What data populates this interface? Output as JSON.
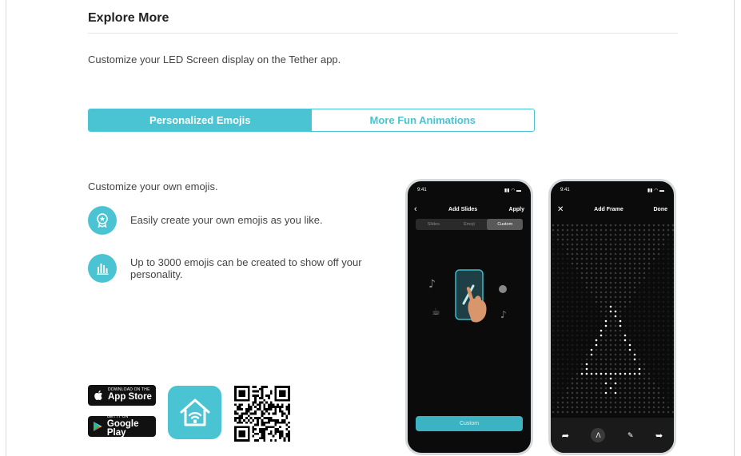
{
  "section_title": "Explore More",
  "subtitle": "Customize your LED Screen display on the Tether app.",
  "tabs": [
    {
      "label": "Personalized Emojis",
      "active": true
    },
    {
      "label": "More Fun Animations",
      "active": false
    }
  ],
  "content": {
    "heading": "Customize your own emojis.",
    "features": [
      {
        "icon": "badge-star-icon",
        "text": "Easily create your own emojis as you like."
      },
      {
        "icon": "bar-chart-icon",
        "text": "Up to 3000 emojis can be created to show off your personality."
      }
    ]
  },
  "downloads": {
    "appstore_small": "DOWNLOAD ON THE",
    "appstore_big": "App Store",
    "googleplay_small": "GET IT ON",
    "googleplay_big": "Google Play",
    "app_logo_icon": "tether-house-wifi-icon",
    "qr_icon": "qr-code-icon"
  },
  "phone1": {
    "time": "9:41",
    "title": "Add Slides",
    "action": "Apply",
    "segments": [
      "Slides",
      "Emoji",
      "Custom"
    ],
    "active_segment": "Custom",
    "button": "Custom"
  },
  "phone2": {
    "time": "9:41",
    "title": "Add Frame",
    "action": "Done",
    "tools": [
      "undo-icon",
      "pen-icon",
      "eraser-icon",
      "redo-icon"
    ]
  },
  "colors": {
    "accent": "#4ac4d2",
    "text": "#444444",
    "phone_bg": "#0b0b0b"
  }
}
